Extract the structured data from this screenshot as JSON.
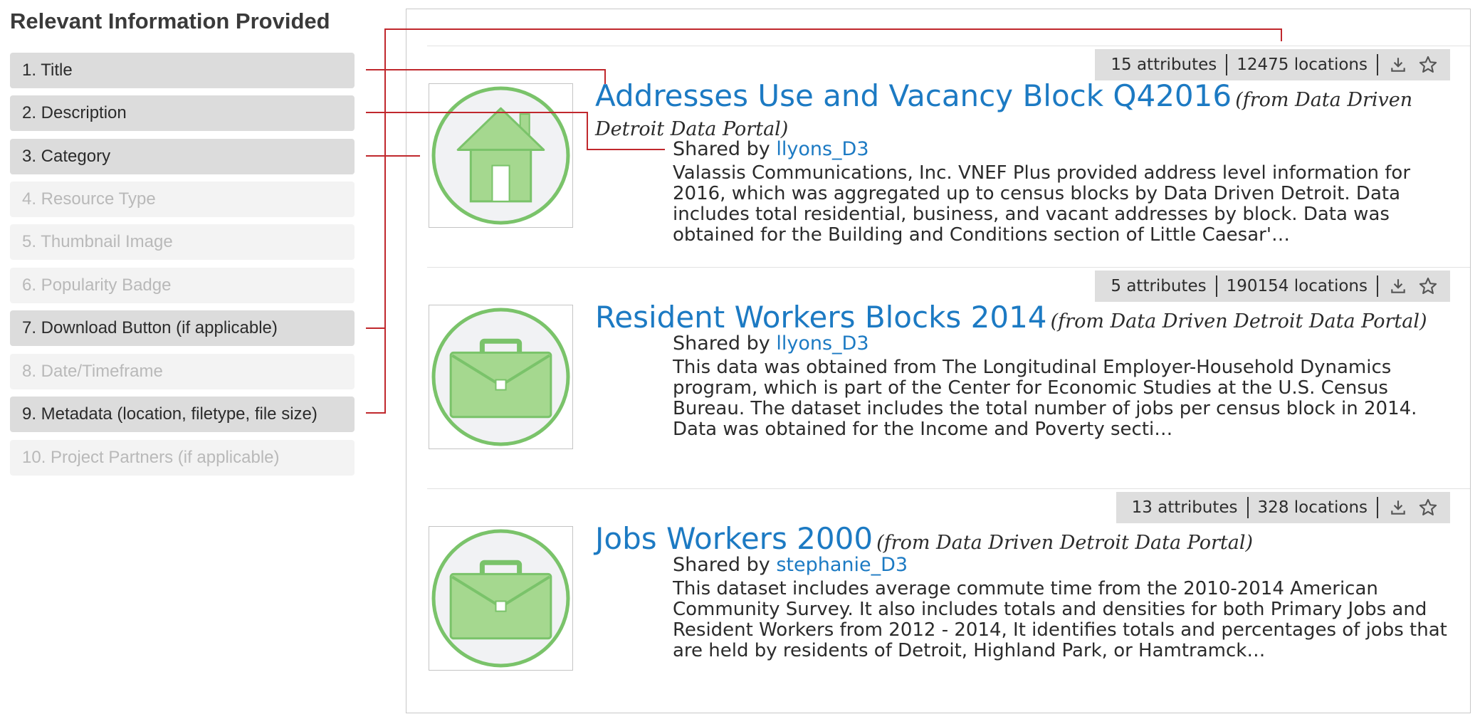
{
  "legend": {
    "title": "Relevant Information Provided",
    "items": [
      {
        "label": "1. Title",
        "active": true
      },
      {
        "label": "2. Description",
        "active": true
      },
      {
        "label": "3. Category",
        "active": true
      },
      {
        "label": "4. Resource Type",
        "active": false
      },
      {
        "label": "5. Thumbnail Image",
        "active": false
      },
      {
        "label": "6. Popularity Badge",
        "active": false
      },
      {
        "label": "7. Download Button (if applicable)",
        "active": true
      },
      {
        "label": "8. Date/Timeframe",
        "active": false
      },
      {
        "label": "9. Metadata (location, filetype, file size)",
        "active": true
      },
      {
        "label": "10. Project Partners (if applicable)",
        "active": false
      }
    ]
  },
  "colors": {
    "connector": "#c0282d",
    "link": "#1c7ac3",
    "icon_green": "#7ac36a",
    "icon_fill": "#a5d88f"
  },
  "results": [
    {
      "title": "Addresses Use and Vacancy Block Q42016",
      "source": "(from Data Driven Detroit Data Portal)",
      "shared_prefix": "Shared by",
      "author": "llyons_D3",
      "description": "Valassis Communications, Inc. VNEF Plus provided address level information for 2016, which was aggregated up to census blocks by Data Driven Detroit. Data includes total residential, business, and vacant addresses by block. Data was obtained for the Building and Conditions section of Little Caesar'…",
      "attributes": "15 attributes",
      "locations": "12475 locations",
      "icon": "house-icon"
    },
    {
      "title": "Resident Workers Blocks 2014",
      "source": "(from Data Driven Detroit Data Portal)",
      "shared_prefix": "Shared by",
      "author": "llyons_D3",
      "description": "This data was obtained from The Longitudinal Employer-Household Dynamics program, which is part of the Center for Economic Studies at the U.S. Census Bureau. The dataset includes the total number of jobs per census block in 2014. Data was obtained for the Income and Poverty secti…",
      "attributes": "5 attributes",
      "locations": "190154 locations",
      "icon": "briefcase-icon"
    },
    {
      "title": "Jobs Workers 2000",
      "source": "(from Data Driven Detroit Data Portal)",
      "shared_prefix": "Shared by",
      "author": "stephanie_D3",
      "description": "This dataset includes average commute time from the 2010-2014 American Community Survey. It also includes totals and densities for both Primary Jobs and Resident Workers from 2012 - 2014, It identifies totals and percentages of jobs that are held by residents of Detroit, Highland Park, or Hamtramck…",
      "attributes": "13 attributes",
      "locations": "328 locations",
      "icon": "briefcase-icon"
    }
  ]
}
